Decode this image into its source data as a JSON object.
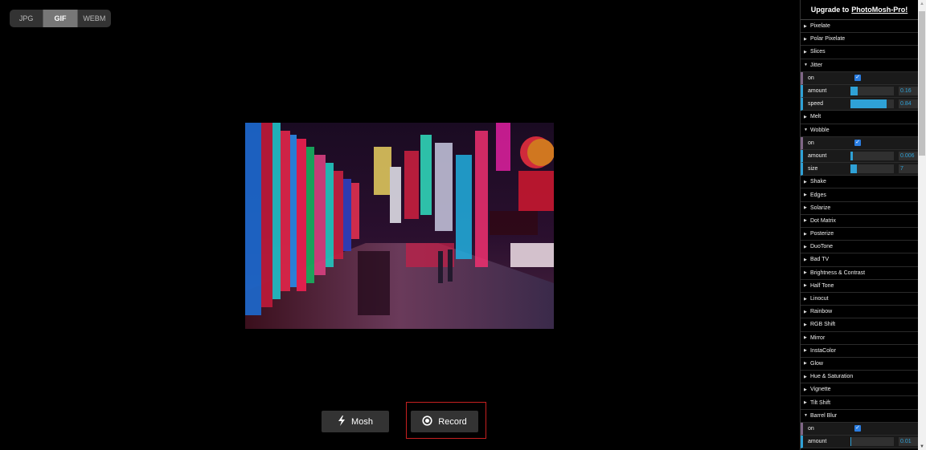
{
  "format_toggle": {
    "options": [
      "JPG",
      "GIF",
      "WEBM"
    ],
    "selected": "GIF"
  },
  "actions": {
    "mosh_label": "Mosh",
    "mosh_icon": "lightning-icon",
    "record_label": "Record",
    "record_icon": "record-icon"
  },
  "sidebar": {
    "title_prefix": "Upgrade to",
    "title_link": "PhotoMosh-Pro!",
    "effects": [
      {
        "name": "Pixelate",
        "open": false
      },
      {
        "name": "Polar Pixelate",
        "open": false
      },
      {
        "name": "Slices",
        "open": false
      },
      {
        "name": "Jitter",
        "open": true,
        "controls": [
          {
            "type": "bool",
            "label": "on",
            "checked": true
          },
          {
            "type": "slider",
            "label": "amount",
            "value": "0.16",
            "fraction": 0.16
          },
          {
            "type": "slider",
            "label": "speed",
            "value": "0.84",
            "fraction": 0.84
          }
        ]
      },
      {
        "name": "Melt",
        "open": false
      },
      {
        "name": "Wobble",
        "open": true,
        "controls": [
          {
            "type": "bool",
            "label": "on",
            "checked": true
          },
          {
            "type": "slider",
            "label": "amount",
            "value": "0.006",
            "fraction": 0.06
          },
          {
            "type": "slider",
            "label": "size",
            "value": "7",
            "fraction": 0.15
          }
        ]
      },
      {
        "name": "Shake",
        "open": false
      },
      {
        "name": "Edges",
        "open": false
      },
      {
        "name": "Solarize",
        "open": false
      },
      {
        "name": "Dot Matrix",
        "open": false
      },
      {
        "name": "Posterize",
        "open": false
      },
      {
        "name": "DuoTone",
        "open": false
      },
      {
        "name": "Bad TV",
        "open": false
      },
      {
        "name": "Brightness & Contrast",
        "open": false
      },
      {
        "name": "Half Tone",
        "open": false
      },
      {
        "name": "Linocut",
        "open": false
      },
      {
        "name": "Rainbow",
        "open": false
      },
      {
        "name": "RGB Shift",
        "open": false
      },
      {
        "name": "Mirror",
        "open": false
      },
      {
        "name": "InstaColor",
        "open": false
      },
      {
        "name": "Glow",
        "open": false
      },
      {
        "name": "Hue & Saturation",
        "open": false
      },
      {
        "name": "Vignette",
        "open": false
      },
      {
        "name": "Tilt Shift",
        "open": false
      },
      {
        "name": "Barrel Blur",
        "open": true,
        "controls": [
          {
            "type": "bool",
            "label": "on",
            "checked": true
          },
          {
            "type": "slider",
            "label": "amount",
            "value": "0.01",
            "fraction": 0.01
          }
        ]
      }
    ]
  },
  "colors": {
    "accent": "#2fa1d6",
    "bool_marker": "#806787",
    "record_frame": "#c62020"
  }
}
